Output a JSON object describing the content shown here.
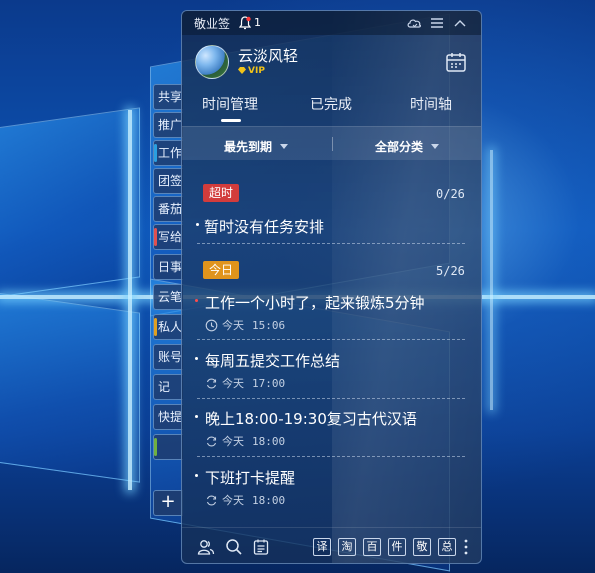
{
  "widget": {
    "title": "敬业签",
    "notification_count": "1"
  },
  "user": {
    "name": "云淡风轻",
    "vip": "VIP"
  },
  "tabs": [
    {
      "label": "时间管理",
      "active": true
    },
    {
      "label": "已完成",
      "active": false
    },
    {
      "label": "时间轴",
      "active": false
    }
  ],
  "filters": {
    "sort": "最先到期",
    "category": "全部分类"
  },
  "sections": {
    "overdue": {
      "label": "超时",
      "count": "0/26",
      "color": "#d23c3c",
      "empty_text": "暂时没有任务安排"
    },
    "today": {
      "label": "今日",
      "count": "5/26",
      "color": "#e0941c"
    }
  },
  "tasks": [
    {
      "title": "工作一个小时了，起来锻炼5分钟",
      "day": "今天",
      "time": "15:06",
      "icon": "clock-icon"
    },
    {
      "title": "每周五提交工作总结",
      "day": "今天",
      "time": "17:00",
      "icon": "repeat-icon"
    },
    {
      "title": "晚上18:00-19:30复习古代汉语",
      "day": "今天",
      "time": "18:00",
      "icon": "repeat-icon"
    },
    {
      "title": "下班打卡提醒",
      "day": "今天",
      "time": "18:00",
      "icon": "repeat-icon"
    }
  ],
  "side_tabs": [
    {
      "label": "共享",
      "mark": ""
    },
    {
      "label": "推广",
      "mark": ""
    },
    {
      "label": "工作",
      "mark": "#2aa0e0"
    },
    {
      "label": "团签",
      "mark": ""
    },
    {
      "label": "番茄",
      "mark": ""
    },
    {
      "label": "写给",
      "mark": "#e05050"
    },
    {
      "label": "日事",
      "mark": ""
    },
    {
      "label": "云笔",
      "mark": ""
    },
    {
      "label": "私人",
      "mark": "#e0a020"
    },
    {
      "label": "账号",
      "mark": ""
    },
    {
      "label": "记",
      "mark": ""
    },
    {
      "label": "快提",
      "mark": ""
    },
    {
      "label": "",
      "mark": "#70b040"
    }
  ],
  "side_add_label": "+",
  "quick_buttons": [
    "译",
    "淘",
    "百",
    "件",
    "敬",
    "总"
  ]
}
